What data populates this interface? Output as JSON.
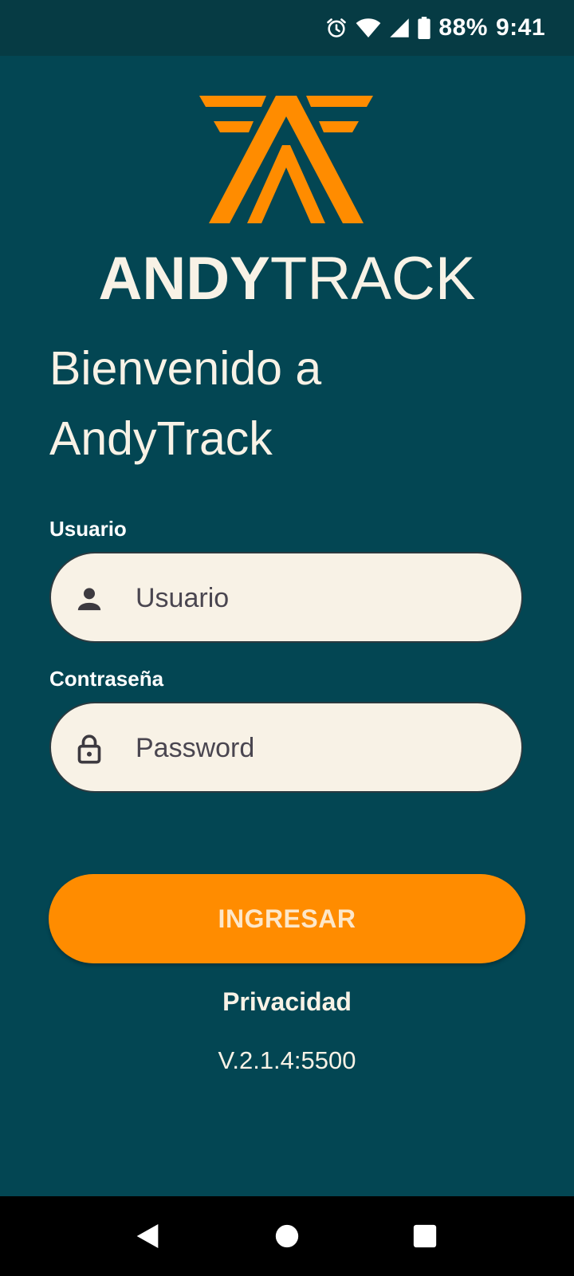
{
  "status_bar": {
    "battery": "88%",
    "time": "9:41"
  },
  "brand": {
    "name_bold": "ANDY",
    "name_light": "TRACK"
  },
  "welcome": {
    "line1": "Bienvenido a",
    "line2": "AndyTrack"
  },
  "form": {
    "username_label": "Usuario",
    "username_placeholder": "Usuario",
    "username_value": "",
    "password_label": "Contraseña",
    "password_placeholder": "Password",
    "password_value": "",
    "submit_label": "INGRESAR"
  },
  "privacy_label": "Privacidad",
  "version": "V.2.1.4:5500",
  "icons": {
    "status": [
      "alarm-icon",
      "wifi-icon",
      "cell-signal-icon",
      "battery-icon"
    ],
    "fields": [
      "person-icon",
      "lock-icon"
    ],
    "nav": [
      "back-icon",
      "home-icon",
      "recents-icon"
    ]
  },
  "colors": {
    "background": "#034653",
    "status_bar": "#063b44",
    "accent": "#ff8c00",
    "field_fill": "#f8f2e6",
    "text_light": "#f8f2e6"
  }
}
